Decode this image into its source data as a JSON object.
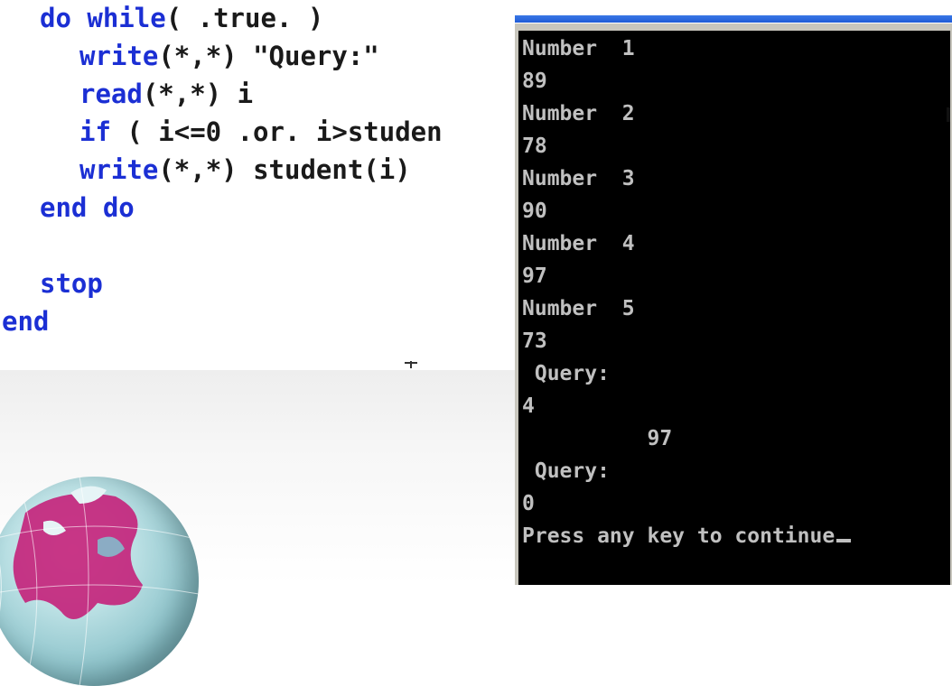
{
  "code": {
    "lines": [
      {
        "kw": "do while",
        "rest": "( .true. )"
      },
      {
        "kw": "write",
        "rest": "(*,*) \"Query:\""
      },
      {
        "kw": "read",
        "rest": "(*,*) i"
      },
      {
        "kw": "if",
        "rest": " ( i<=0 .or. i>studen"
      },
      {
        "kw": "write",
        "rest": "(*,*) student(i)"
      },
      {
        "kw": "end do",
        "rest": ""
      },
      {
        "kw": "stop",
        "rest": ""
      },
      {
        "kw": "end",
        "rest": ""
      }
    ]
  },
  "console": {
    "lines": [
      "Number  1",
      "89",
      "Number  2",
      "78",
      "Number  3",
      "90",
      "Number  4",
      "97",
      "Number  5",
      "73",
      " Query:",
      "4",
      "          97",
      " Query:",
      "0",
      "Press any key to continue"
    ]
  },
  "colors": {
    "keyword": "#1b2fd4",
    "code_text": "#1a1a1a",
    "console_bg": "#000000",
    "console_text": "#c0c0c0",
    "titlebar": "#1f5bd6"
  }
}
